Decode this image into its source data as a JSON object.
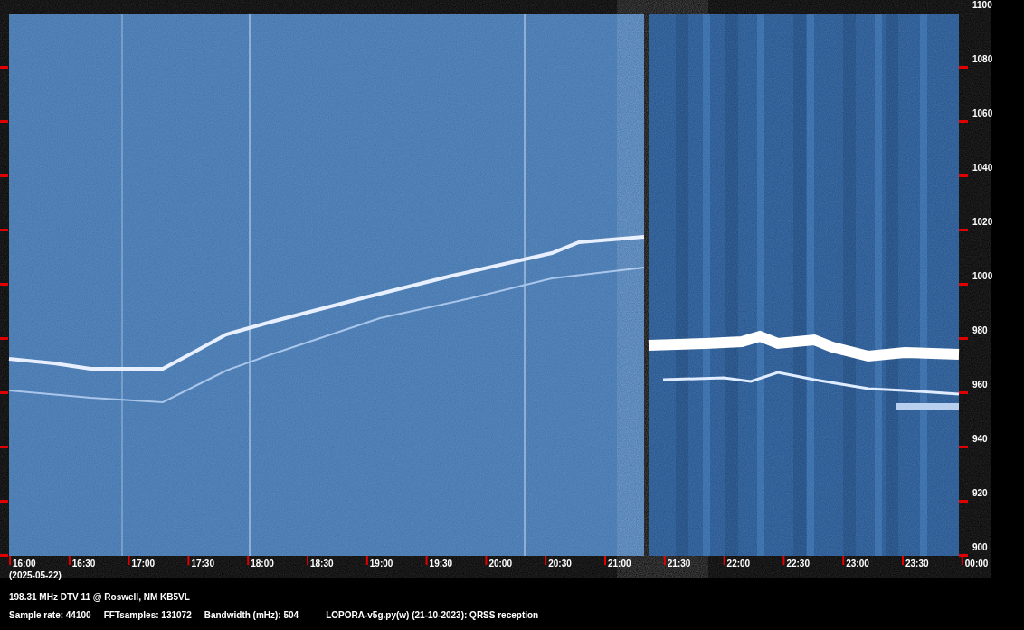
{
  "spectrogram": {
    "y_axis_labels": [
      "1100",
      "1080",
      "1060",
      "1040",
      "1020",
      "1000",
      "980",
      "960",
      "940",
      "920",
      "900"
    ],
    "x_axis_labels": [
      "16:00",
      "16:30",
      "17:00",
      "17:30",
      "18:00",
      "18:30",
      "19:00",
      "19:30",
      "20:00",
      "20:30",
      "21:00",
      "21:30",
      "22:00",
      "22:30",
      "23:00",
      "23:30",
      "00:00"
    ],
    "date": "(2025-05-22)"
  },
  "footer": {
    "station": "198.31 MHz DTV 11 @ Roswell, NM KB5VL",
    "settings": [
      "Sample rate: 44100",
      "FFTsamples: 131072",
      "Bandwidth (mHz): 504"
    ],
    "software": "LOPORA-v5g.py(w) (21-10-2023): QRSS reception"
  }
}
